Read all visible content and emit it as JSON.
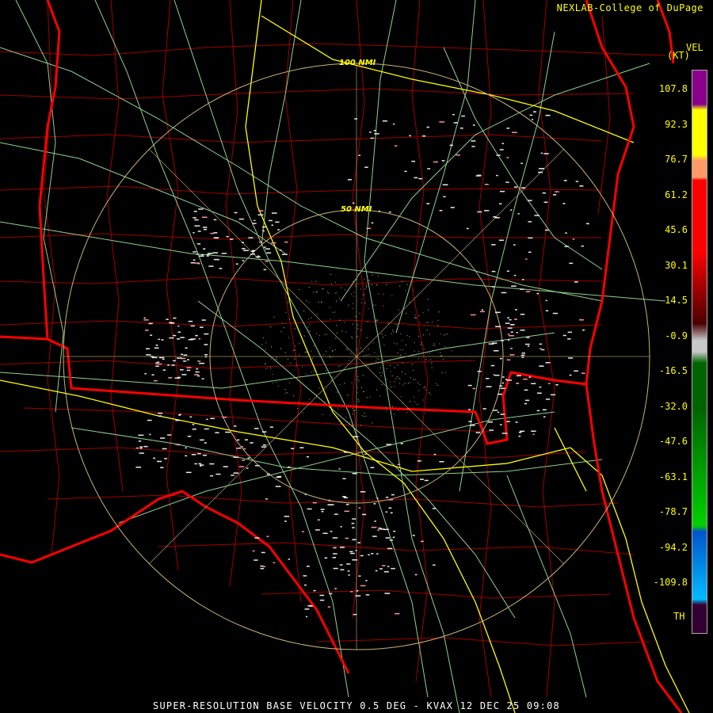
{
  "header": {
    "credit": "NEXLAB-College of DuPage"
  },
  "range_rings": [
    {
      "label": "100 NMI"
    },
    {
      "label": "50 NMI"
    }
  ],
  "legend": {
    "title": "VEL",
    "units": "(KT)",
    "ticks": [
      "107.8",
      "92.3",
      "76.7",
      "61.2",
      "45.6",
      "30.1",
      "14.5",
      "-0.9",
      "-16.5",
      "-32.0",
      "-47.6",
      "-63.1",
      "-78.7",
      "-94.2",
      "-109.8"
    ],
    "th_label": "TH",
    "colors": {
      "purple": "#8a008a",
      "yellow": "#ffff00",
      "orange": "#ff9966",
      "red": "#ff0000",
      "dark_red": "#4a0000",
      "gray": "#c8c8c8",
      "dark_green": "#006400",
      "green": "#00cc00",
      "blue": "#0055cc",
      "cyan": "#00bbff",
      "th": "#330033"
    }
  },
  "map_colors": {
    "state_boundary": "#ff0000",
    "county_boundary": "#a00000",
    "highway": "#ffff00",
    "road": "#8fd08f",
    "range_ring": "#c8b27a",
    "echo": "#e8e8e8"
  },
  "footer": {
    "caption": "SUPER-RESOLUTION BASE VELOCITY 0.5 DEG - KVAX 12 DEC 25 09:08"
  }
}
